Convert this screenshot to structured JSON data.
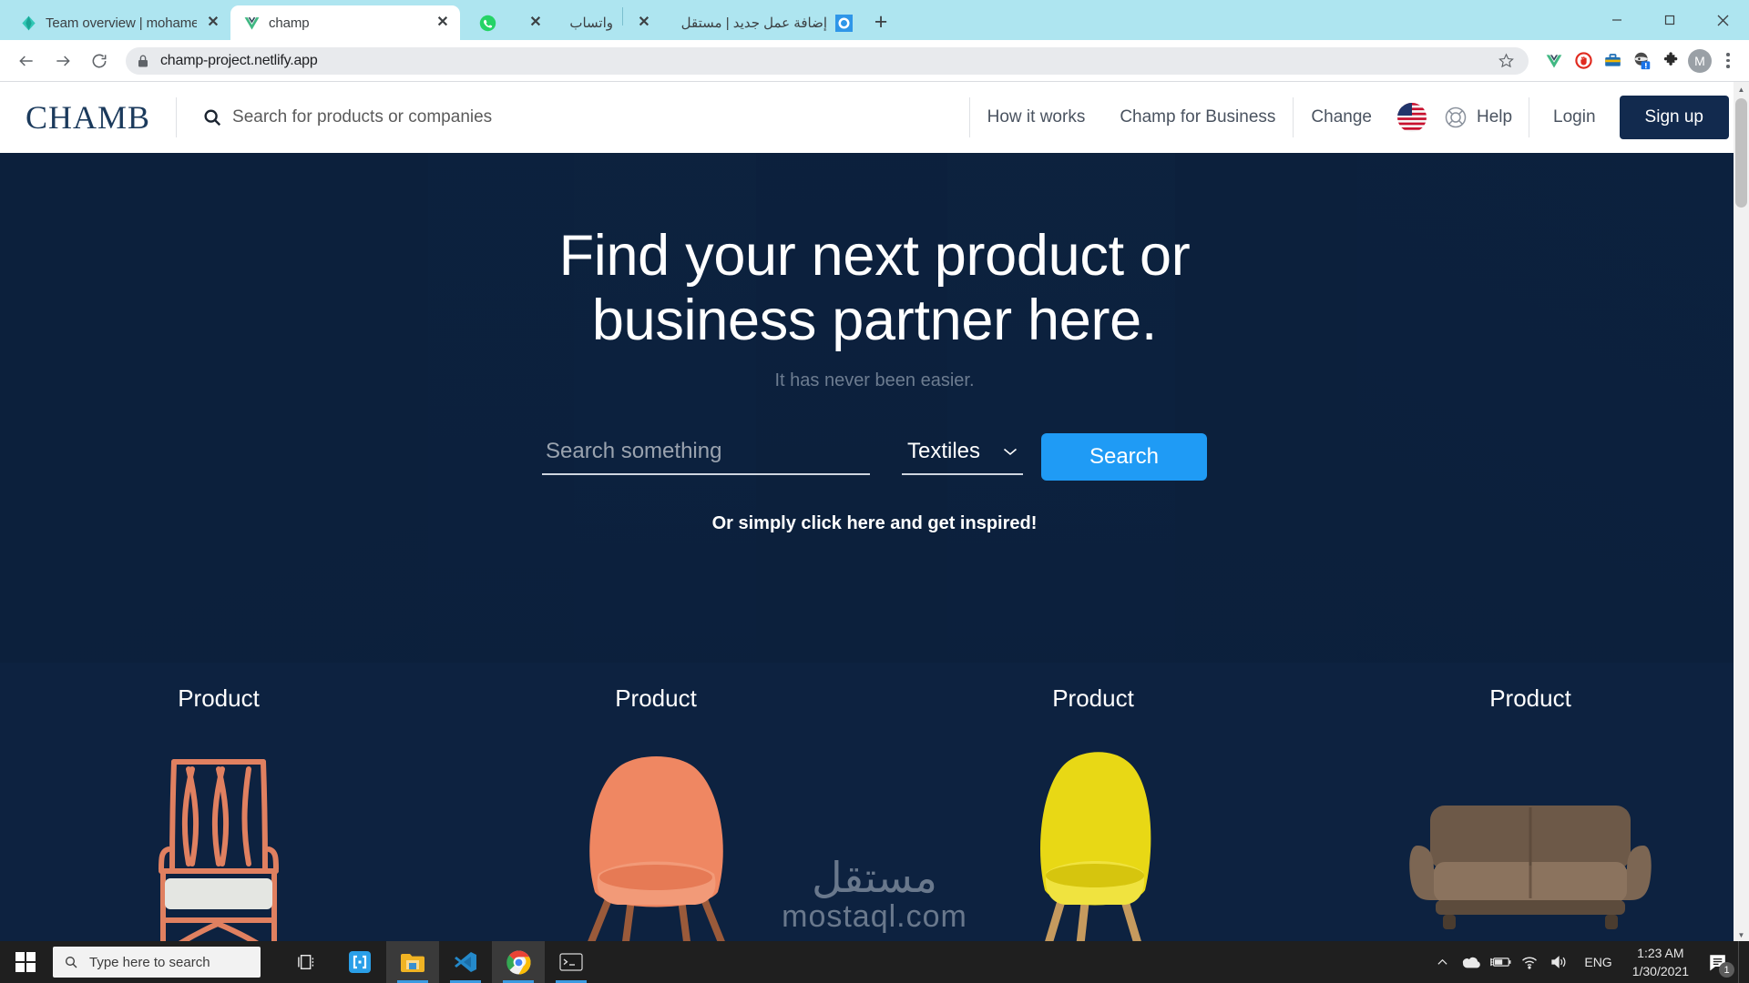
{
  "browser": {
    "tabs": [
      {
        "label": "Team overview | mohamed-ahme",
        "favicon": "diamond-teal-icon",
        "close": "✕",
        "active": false
      },
      {
        "label": "champ",
        "favicon": "vue-icon",
        "close": "✕",
        "active": true
      },
      {
        "label": "",
        "favicon": "whatsapp-icon",
        "close": "",
        "active": false
      },
      {
        "label": "واتساب",
        "favicon": "",
        "close": "✕",
        "active": false
      },
      {
        "label": "إضافة عمل جديد | مستقل",
        "favicon": "mostaql-blue-icon",
        "close": "✕",
        "active": false
      }
    ],
    "new_tab_label": "+",
    "window_controls": {
      "minimize": "minimize-icon",
      "maximize": "maximize-icon",
      "close": "close-icon"
    },
    "toolbar": {
      "back": "back-arrow-icon",
      "forward": "forward-arrow-icon",
      "reload": "reload-icon",
      "lock": "lock-icon",
      "url": "champ-project.netlify.app",
      "bookmark": "star-icon",
      "extensions": [
        "vue-devtools-icon",
        "adblock-icon",
        "toolbox-icon",
        "ninja-icon",
        "puzzle-icon"
      ],
      "profile_initial": "M",
      "menu": "kebab-menu-icon"
    }
  },
  "site": {
    "logo": "CHAMB",
    "nav_search_placeholder": "Search for products or companies",
    "nav_links": [
      {
        "label": "How it works"
      },
      {
        "label": "Champ for Business"
      },
      {
        "label": "Change"
      }
    ],
    "flag": "us-flag-icon",
    "help_label": "Help",
    "help_icon": "lifebuoy-icon",
    "login_label": "Login",
    "signup_label": "Sign up",
    "colors": {
      "brand_dark": "#122a4e",
      "hero_bg": "#0b1f3b",
      "accent_blue": "#1f9bf5",
      "logo_navy": "#1b3a5c"
    }
  },
  "hero": {
    "title_line1": "Find your next product or",
    "title_line2": "business partner here.",
    "subtitle": "It has never been easier.",
    "search_placeholder": "Search something",
    "category_selected": "Textiles",
    "category_options": [
      "Textiles"
    ],
    "dropdown_icon": "chevron-down-icon",
    "search_button": "Search",
    "inspire_text": "Or simply click here and get inspired!"
  },
  "products": [
    {
      "title": "Product",
      "image": "armchair-wood-frame-coral"
    },
    {
      "title": "Product",
      "image": "coral-upholstered-armchair"
    },
    {
      "title": "Product",
      "image": "yellow-tub-chair"
    },
    {
      "title": "Product",
      "image": "brown-two-seat-sofa"
    }
  ],
  "watermark": {
    "arabic": "مستقل",
    "latin": "mostaql.com"
  },
  "taskbar": {
    "start": "windows-start-icon",
    "search_placeholder": "Type here to search",
    "search_icon": "search-icon",
    "pinned": [
      {
        "name": "task-view-icon"
      },
      {
        "name": "brackets-editor-icon"
      },
      {
        "name": "file-explorer-icon"
      },
      {
        "name": "vscode-icon"
      },
      {
        "name": "chrome-icon"
      },
      {
        "name": "terminal-icon"
      }
    ],
    "tray": {
      "chevron": "show-hidden-icons-icon",
      "onedrive": "onedrive-icon",
      "battery": "battery-charging-icon",
      "wifi": "wifi-icon",
      "volume": "volume-icon",
      "language": "ENG",
      "time": "1:23 AM",
      "date": "1/30/2021",
      "notifications": "notification-icon",
      "notification_count": "1"
    }
  }
}
